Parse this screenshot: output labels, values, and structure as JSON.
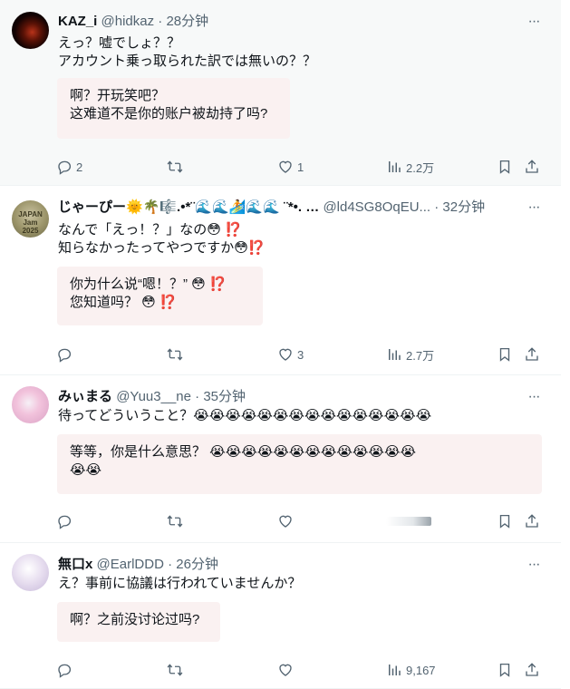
{
  "tweets": [
    {
      "name": "KAZ_i",
      "handle": "@hidkaz",
      "time": "28分钟",
      "text": "えっ？嘘でしょ？？\nアカウント乗っ取られた訳では無いの？？",
      "translation": "啊？开玩笑吧？\n这难道不是你的账户被劫持了吗?",
      "replies": "2",
      "retweets": "",
      "likes": "1",
      "views": "2.2万"
    },
    {
      "name": "じゃーぴー🌞🌴🎼.•*¨🌊🌊🏄🌊🌊 ¨*•. …",
      "handle": "@ld4SG8OqEU...",
      "time": "32分钟",
      "avatar_text": "JAPAN\nJam\n2025",
      "text": "なんで「えっ！？」なの😳 ⁉️\n知らなかったってやつですか😳⁉️",
      "translation": "你为什么说“嗯！？” 😳 ⁉️\n您知道吗？ 😳 ⁉️",
      "replies": "",
      "retweets": "",
      "likes": "3",
      "views": "2.7万"
    },
    {
      "name": "みぃまる",
      "handle": "@Yuu3__ne",
      "time": "35分钟",
      "text": "待ってどういうこと？😭😭😭😭😭😭😭😭😭😭😭😭😭😭😭",
      "translation": "等等，你是什么意思？ 😭😭😭😭😭😭😭😭😭😭😭😭😭\n😭😭",
      "replies": "",
      "retweets": "",
      "likes": "",
      "views": ""
    },
    {
      "name": "無口x",
      "handle": "@EarlDDD",
      "time": "26分钟",
      "text": "え？事前に協議は行われていませんか？",
      "translation": "啊？之前没讨论过吗?",
      "replies": "",
      "retweets": "",
      "likes": "",
      "views": "9,167"
    }
  ],
  "ui": {
    "separator": "·",
    "more": "···"
  },
  "colors": {
    "text": "#0f1419",
    "secondary": "#536471",
    "translation_bg": "#faf1f1",
    "highlight_bg": "#f7f9f9"
  },
  "icons": [
    "reply-icon",
    "retweet-icon",
    "like-icon",
    "views-icon",
    "bookmark-icon",
    "share-icon",
    "more-icon"
  ]
}
